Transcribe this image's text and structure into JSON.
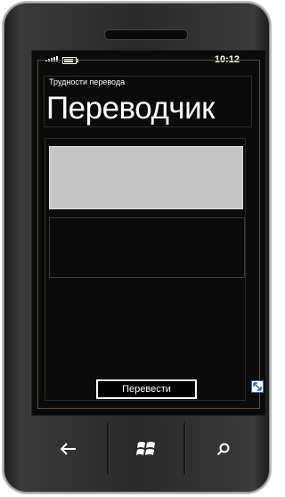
{
  "status_bar": {
    "time": "10:12"
  },
  "app": {
    "app_title": "Трудности перевода",
    "page_title": "Переводчик"
  },
  "translator": {
    "input_text": "",
    "output_text": "",
    "translate_label": "Перевести"
  },
  "nav": {
    "back_icon": "arrow-left-icon",
    "start_icon": "windows-logo-icon",
    "search_icon": "search-icon"
  },
  "colors": {
    "screen_bg": "#0b0b0b",
    "input_bg": "#c6c6c6",
    "accent_frame": "#6d4a28",
    "text": "#ffffff"
  }
}
